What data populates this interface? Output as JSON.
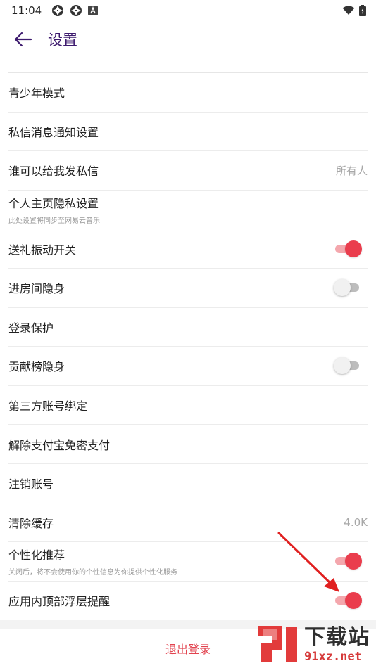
{
  "status_bar": {
    "time": "11:04",
    "left_icons": [
      "aperture-icon",
      "aperture-icon",
      "notification-a-icon"
    ],
    "right_icons": [
      "wifi-icon",
      "battery-icon"
    ]
  },
  "header": {
    "title": "设置",
    "back_icon": "back-arrow-icon",
    "title_color": "#3d1a6e"
  },
  "settings": [
    {
      "label": "青少年模式",
      "type": "link"
    },
    {
      "label": "私信消息通知设置",
      "type": "link"
    },
    {
      "label": "谁可以给我发私信",
      "type": "value",
      "value": "所有人"
    },
    {
      "label": "个人主页隐私设置",
      "type": "link",
      "subtitle": "此处设置将同步至网易云音乐"
    },
    {
      "label": "送礼振动开关",
      "type": "toggle",
      "on": true
    },
    {
      "label": "进房间隐身",
      "type": "toggle",
      "on": false
    },
    {
      "label": "登录保护",
      "type": "link"
    },
    {
      "label": "贡献榜隐身",
      "type": "toggle",
      "on": false
    },
    {
      "label": "第三方账号绑定",
      "type": "link"
    },
    {
      "label": "解除支付宝免密支付",
      "type": "link"
    },
    {
      "label": "注销账号",
      "type": "link"
    },
    {
      "label": "清除缓存",
      "type": "value",
      "value": "4.0K"
    },
    {
      "label": "个性化推荐",
      "type": "toggle",
      "on": true,
      "subtitle": "关闭后，将不会使用你的个性信息为你提供个性化服务"
    },
    {
      "label": "应用内顶部浮层提醒",
      "type": "toggle",
      "on": true
    }
  ],
  "logout_label": "退出登录",
  "watermark": {
    "main": "下载站",
    "sub": "91xz.net"
  },
  "colors": {
    "accent": "#ea3d4d",
    "toggle_on_track": "#f4a7ad",
    "toggle_off_track": "#bdbdbd",
    "logout_text": "#e2434f",
    "annotation_arrow": "#e02020"
  }
}
